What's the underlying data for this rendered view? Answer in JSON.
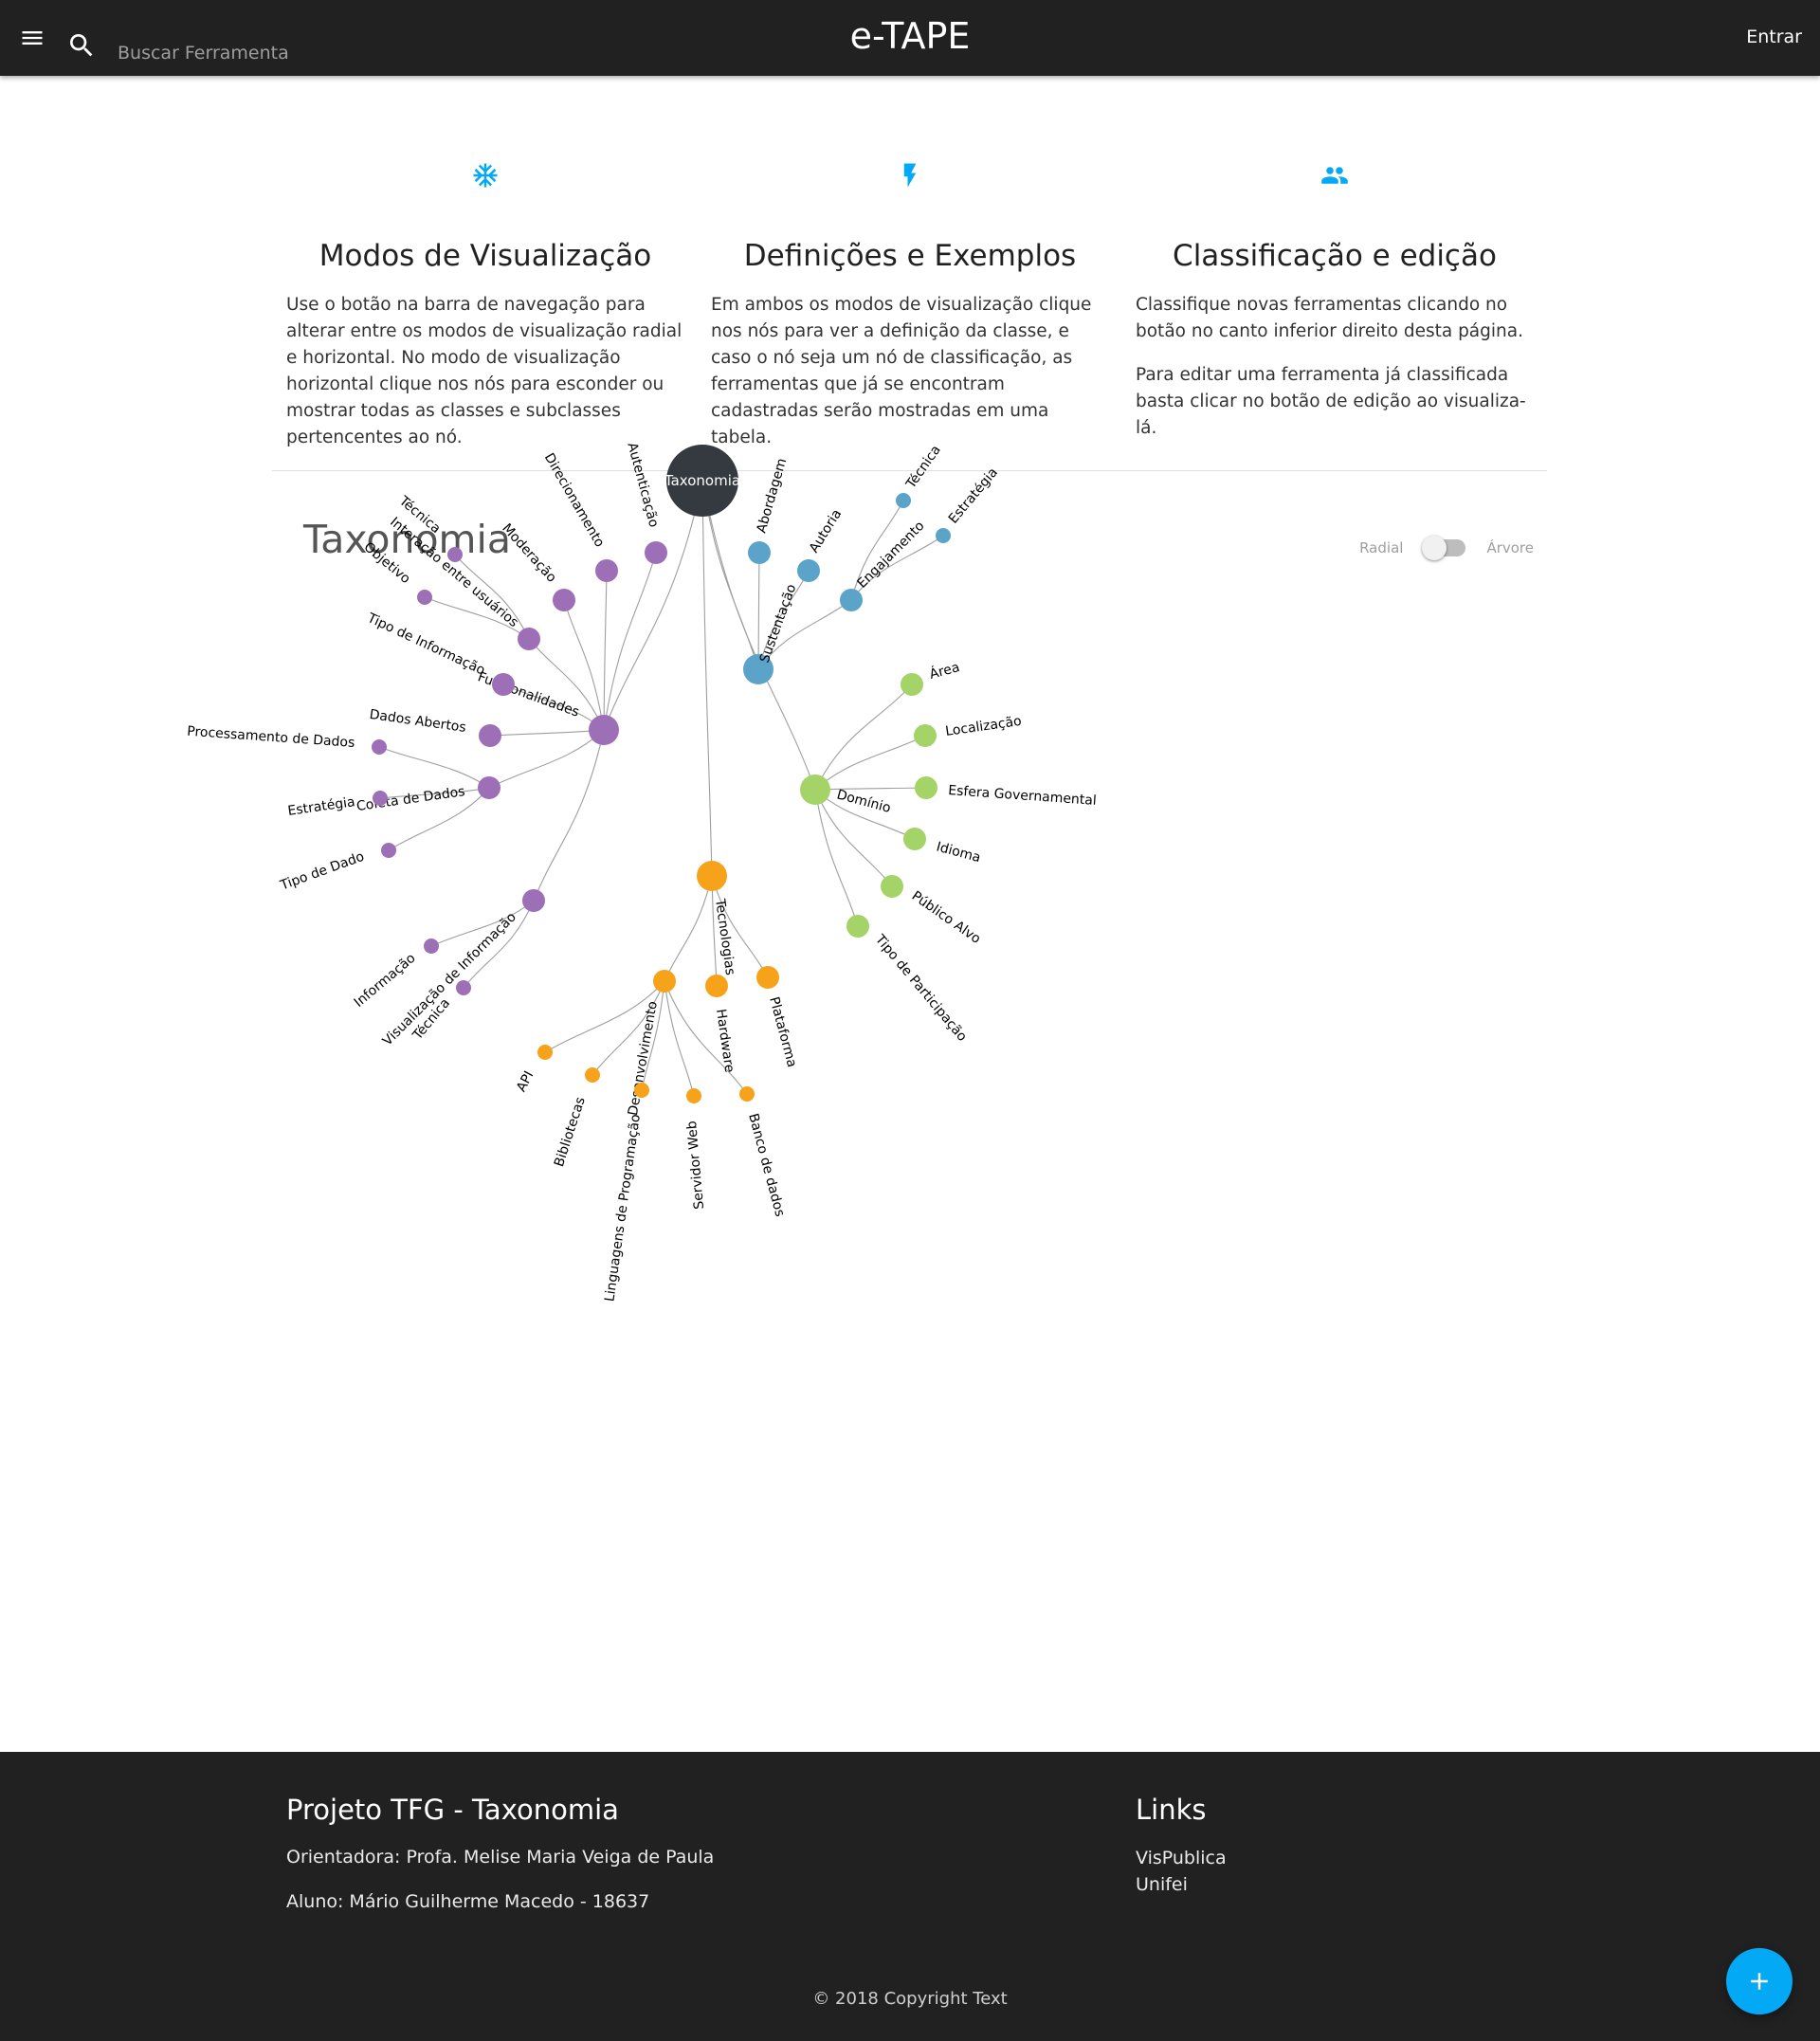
{
  "navbar": {
    "brand": "e-TAPE",
    "search_placeholder": "Buscar Ferramenta",
    "login_label": "Entrar",
    "menu_icon": "menu-icon",
    "search_icon": "search-icon"
  },
  "features": [
    {
      "icon": "snowflake-icon",
      "title": "Modos de Visualização",
      "paragraphs": [
        "Use o botão na barra de navegação para alterar entre os modos de visualização radial e horizontal. No modo de visualização horizontal clique nos nós para esconder ou mostrar todas as classes e subclasses pertencentes ao nó."
      ]
    },
    {
      "icon": "flash-icon",
      "title": "Definições e Exemplos",
      "paragraphs": [
        "Em ambos os modos de visualização clique nos nós para ver a definição da classe, e caso o nó seja um nó de classificação, as ferramentas que já se encontram cadastradas serão mostradas em uma tabela."
      ]
    },
    {
      "icon": "group-icon",
      "title": "Classificação e edição",
      "paragraphs": [
        "Classifique novas ferramentas clicando no botão no canto inferior direito desta página.",
        "Para editar uma ferramenta já classificada basta clicar no botão de edição ao visualiza-lá."
      ]
    }
  ],
  "taxonomy": {
    "title": "Taxonomia",
    "switch_left": "Radial",
    "switch_right": "Árvore",
    "switch_checked": false,
    "colors": {
      "root": "#343a40",
      "Sustentação": "#5ba3c9",
      "Domínio": "#a4d467",
      "Tecnologias": "#f7a21b",
      "Funcionalidades": "#9d6fb7",
      "link": "#9e9e9e"
    },
    "tree": {
      "name": "Taxonomia",
      "children": [
        {
          "name": "Sustentação",
          "children": [
            {
              "name": "Abordagem"
            },
            {
              "name": "Autoria"
            },
            {
              "name": "Engajamento",
              "children": [
                {
                  "name": "Técnica"
                },
                {
                  "name": "Estratégia"
                }
              ]
            }
          ]
        },
        {
          "name": "Domínio",
          "children": [
            {
              "name": "Área"
            },
            {
              "name": "Localização"
            },
            {
              "name": "Esfera Governamental"
            },
            {
              "name": "Idioma"
            },
            {
              "name": "Público Alvo"
            },
            {
              "name": "Tipo de Participação"
            }
          ]
        },
        {
          "name": "Tecnologias",
          "children": [
            {
              "name": "Desenvolvimento",
              "children": [
                {
                  "name": "API"
                },
                {
                  "name": "Bibliotecas"
                },
                {
                  "name": "Linguagens de Programação"
                },
                {
                  "name": "Servidor Web"
                },
                {
                  "name": "Banco de dados"
                }
              ]
            },
            {
              "name": "Hardware"
            },
            {
              "name": "Plataforma"
            }
          ]
        },
        {
          "name": "Funcionalidades",
          "children": [
            {
              "name": "Autenticação"
            },
            {
              "name": "Direcionamento"
            },
            {
              "name": "Moderação"
            },
            {
              "name": "Interação entre usuários",
              "children": [
                {
                  "name": "Técnica"
                },
                {
                  "name": "Objetivo"
                }
              ]
            },
            {
              "name": "Tipo de Informação"
            },
            {
              "name": "Dados Abertos"
            },
            {
              "name": "Coleta de Dados",
              "children": [
                {
                  "name": "Processamento de Dados"
                },
                {
                  "name": "Estratégia"
                },
                {
                  "name": "Tipo de Dado"
                }
              ]
            },
            {
              "name": "Visualização de Informação",
              "children": [
                {
                  "name": "Informação"
                },
                {
                  "name": "Técnica"
                }
              ]
            }
          ]
        }
      ]
    }
  },
  "footer": {
    "project_title": "Projeto TFG - Taxonomia",
    "advisor": "Orientadora: Profa. Melise Maria Veiga de Paula",
    "student": "Aluno: Mário Guilherme Macedo - 18637",
    "links_title": "Links",
    "links": [
      "VisPublica",
      "Unifei"
    ],
    "copyright": "© 2018 Copyright Text"
  },
  "fab": {
    "icon": "plus-icon"
  }
}
